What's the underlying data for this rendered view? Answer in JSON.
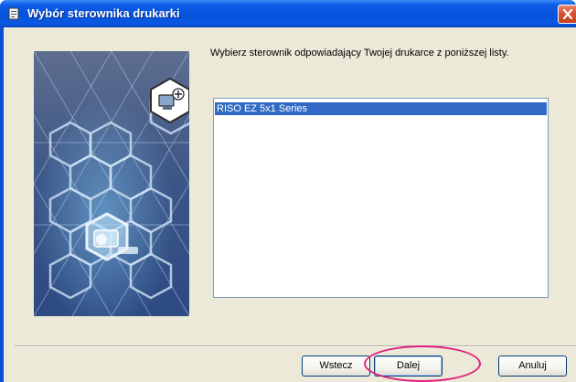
{
  "window": {
    "title": "Wybór sterownika drukarki",
    "title_icon": "printer-driver-icon",
    "close_icon": "close-icon"
  },
  "content": {
    "instruction": "Wybierz sterownik odpowiadający Twojej drukarce z poniższej listy.",
    "side_icons": [
      "computer-add-icon",
      "printer-icon"
    ]
  },
  "driver_list": {
    "items": [
      {
        "label": "RISO EZ 5x1 Series",
        "selected": true
      }
    ]
  },
  "buttons": {
    "back_label": "Wstecz",
    "next_label": "Dalej",
    "cancel_label": "Anuluj"
  },
  "colors": {
    "titlebar": "#0651d9",
    "dialog_background": "#ece9d8",
    "selection": "#316ac5",
    "highlight_annotation": "#e0207e"
  }
}
